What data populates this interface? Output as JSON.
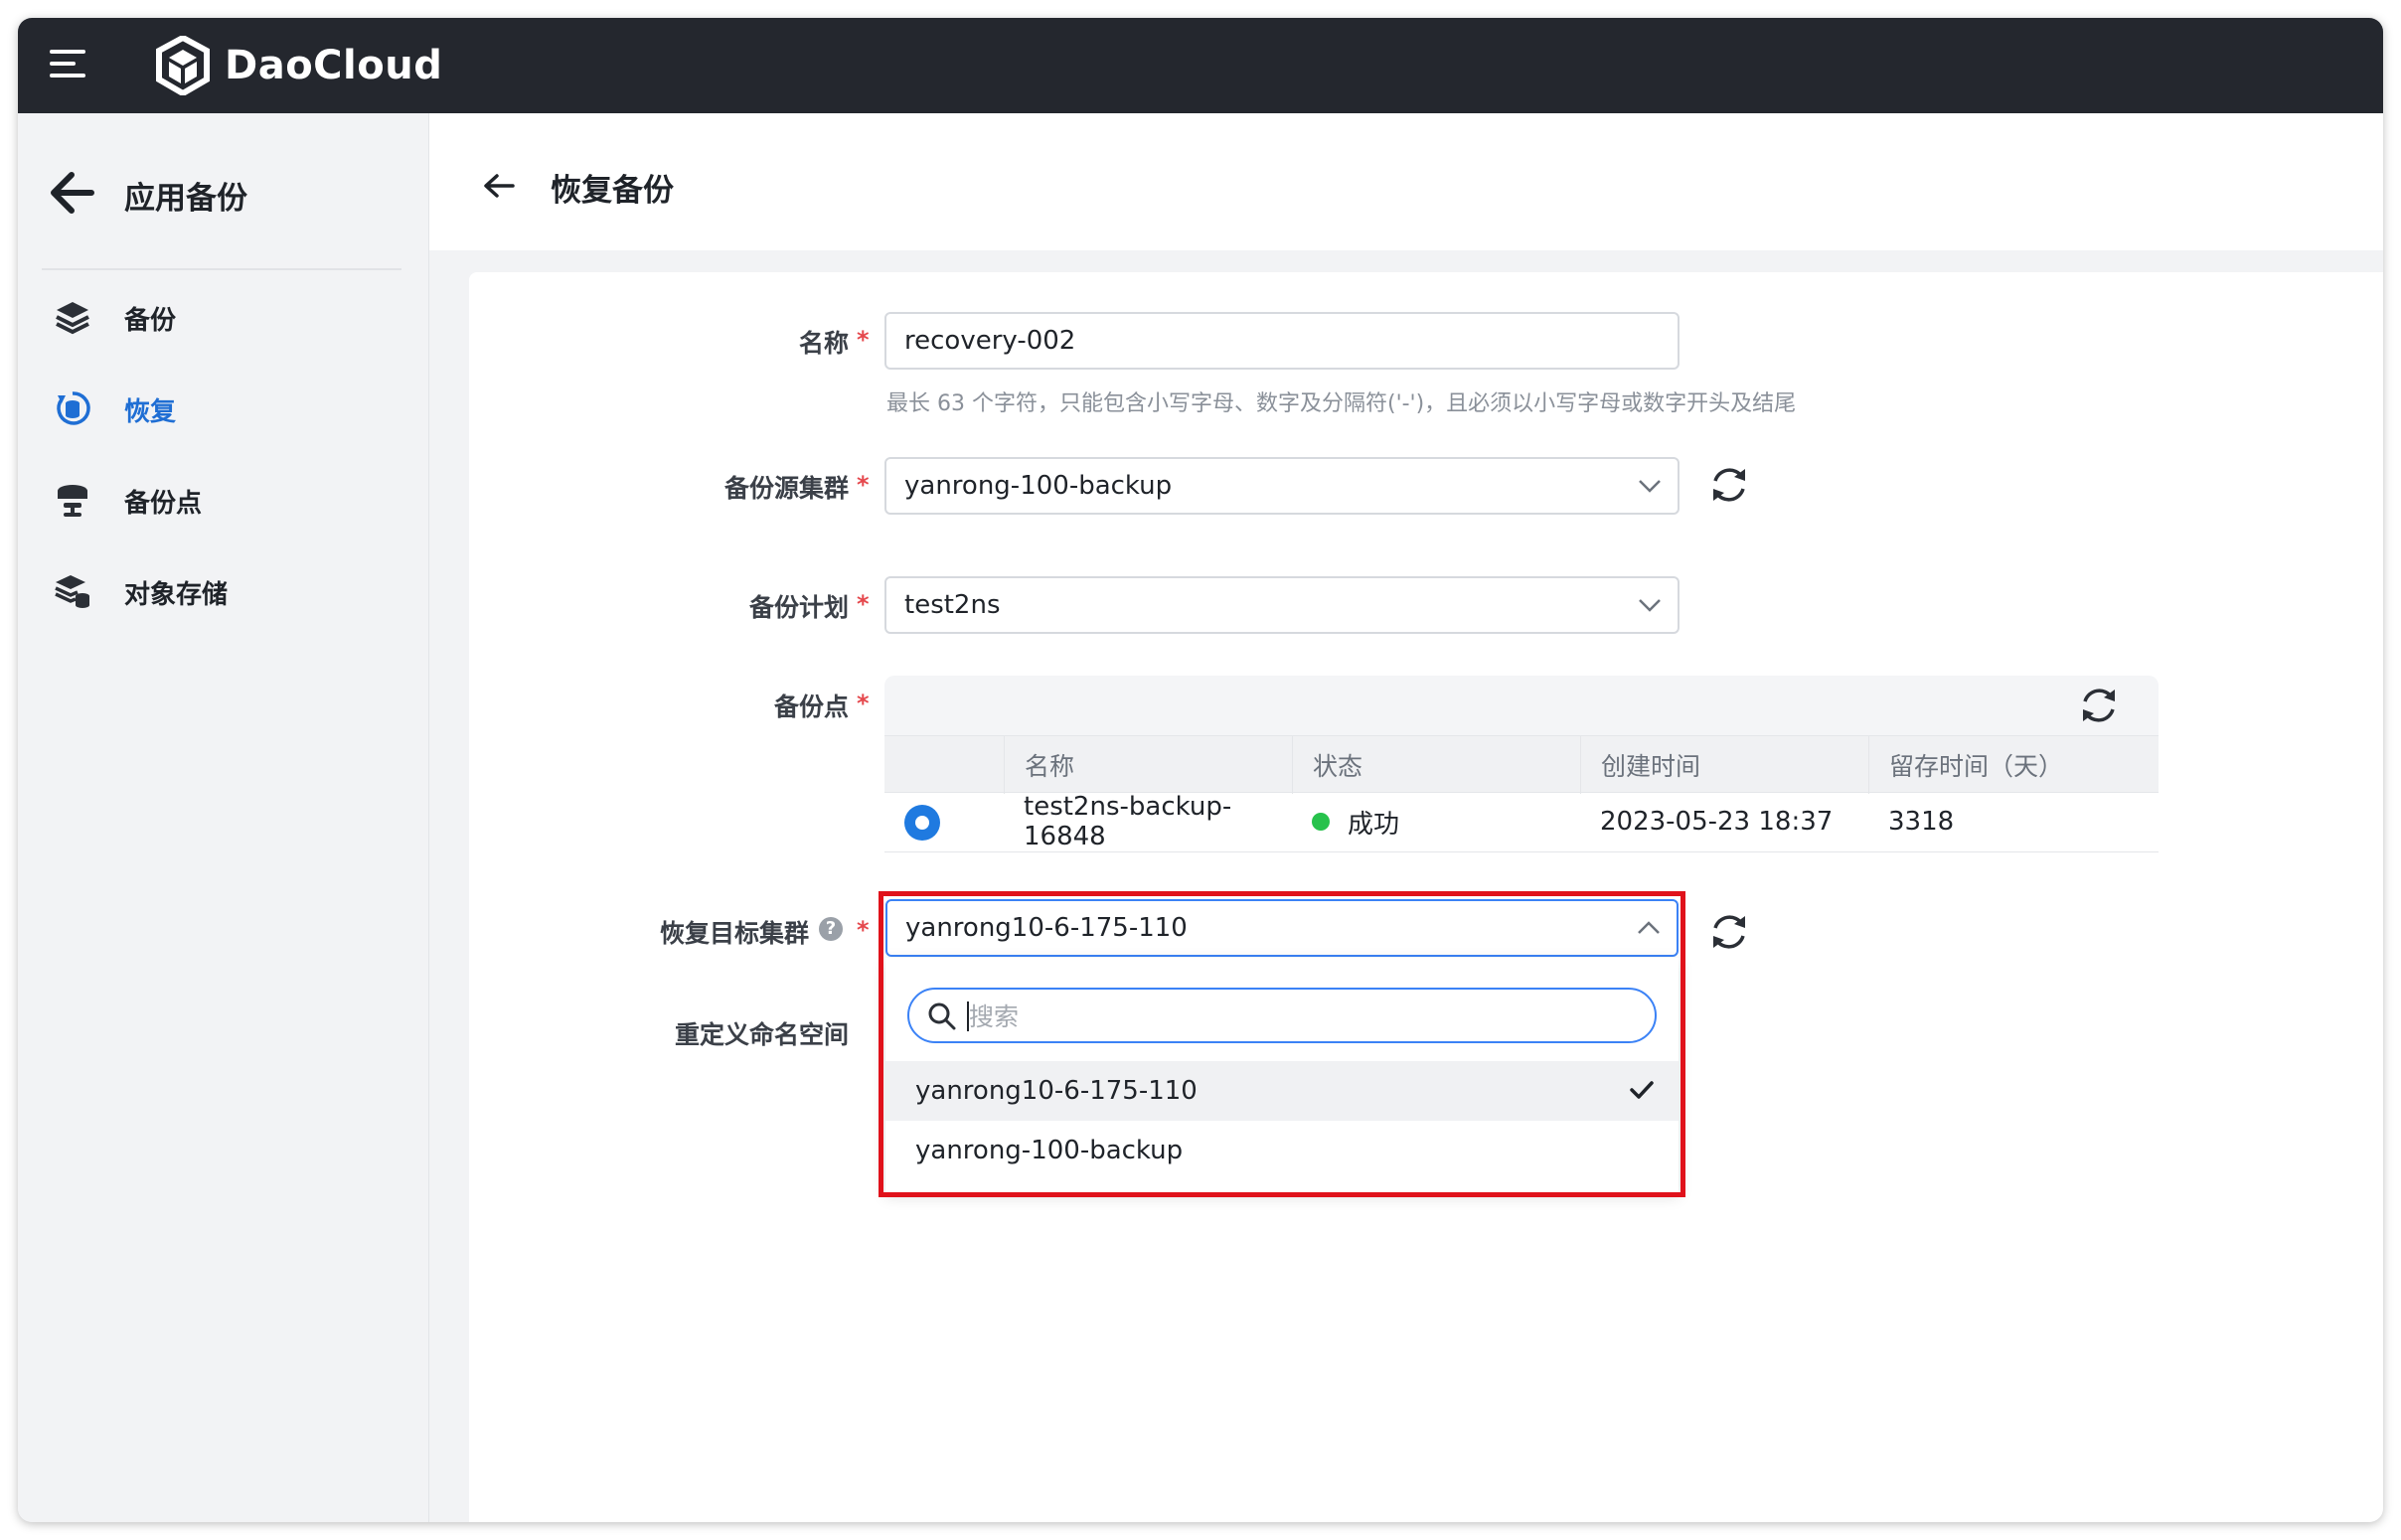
{
  "topbar": {
    "brand": "DaoCloud",
    "menu_icon": "hamburger-menu-icon",
    "logo_icon": "daocloud-logo-icon"
  },
  "sidebar": {
    "title": "应用备份",
    "items": [
      {
        "label": "备份",
        "icon": "layers-icon",
        "active": false
      },
      {
        "label": "恢复",
        "icon": "restore-icon",
        "active": true
      },
      {
        "label": "备份点",
        "icon": "backup-point-icon",
        "active": false
      },
      {
        "label": "对象存储",
        "icon": "object-storage-icon",
        "active": false
      }
    ]
  },
  "header": {
    "title": "恢复备份"
  },
  "form": {
    "name": {
      "label": "名称",
      "value": "recovery-002",
      "hint": "最长 63 个字符，只能包含小写字母、数字及分隔符('-')，且必须以小写字母或数字开头及结尾"
    },
    "source_cluster": {
      "label": "备份源集群",
      "value": "yanrong-100-backup"
    },
    "plan": {
      "label": "备份计划",
      "value": "test2ns"
    },
    "backup_point": {
      "label": "备份点",
      "columns": [
        "名称",
        "状态",
        "创建时间",
        "留存时间（天）"
      ],
      "rows": [
        {
          "name": "test2ns-backup-16848",
          "status": "成功",
          "created": "2023-05-23 18:37",
          "retention": "3318"
        }
      ]
    },
    "target_cluster": {
      "label": "恢复目标集群",
      "value": "yanrong10-6-175-110",
      "search_placeholder": "搜索",
      "options": [
        {
          "label": "yanrong10-6-175-110",
          "selected": true
        },
        {
          "label": "yanrong-100-backup",
          "selected": false
        }
      ]
    },
    "namespace": {
      "label": "重定义命名空间"
    }
  },
  "colors": {
    "accent": "#1f6ed4",
    "highlight": "#e0121b",
    "success": "#27c24c",
    "topbar": "#24272e"
  }
}
